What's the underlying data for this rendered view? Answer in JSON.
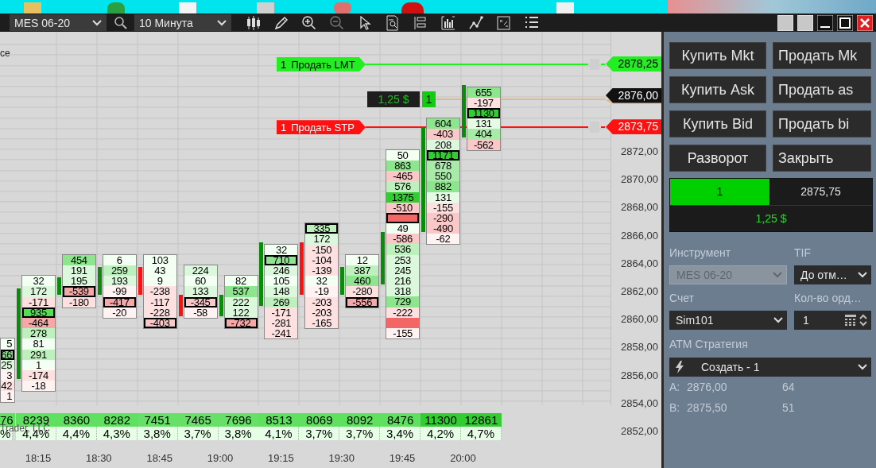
{
  "toolbar": {
    "instrument": "MES 06-20",
    "interval": "10 Минута"
  },
  "chart": {
    "corner_label": "ce",
    "copyright": "Trader, LLC",
    "columns": [
      {
        "volume": "76",
        "percent": "%",
        "color": "#5fe05f",
        "cells": [
          {
            "text": "5",
            "color": "#f2fff2",
            "highlighted": false
          },
          {
            "text": "66",
            "color": "#8de68d",
            "highlighted": true
          },
          {
            "text": "25",
            "color": "#dcf8dc",
            "highlighted": false
          },
          {
            "text": "3",
            "color": "#fff2f2",
            "highlighted": false
          },
          {
            "text": "42",
            "color": "#fde0e0",
            "highlighted": false
          },
          {
            "text": "1",
            "color": "#fff2f2",
            "highlighted": false
          }
        ]
      },
      {
        "volume": "8239",
        "percent": "4,4%",
        "color": "#5fe05f",
        "candle": {
          "color": "#0b8a0b"
        },
        "cells": [
          {
            "text": "32",
            "color": "#f2fff2",
            "highlighted": false
          },
          {
            "text": "172",
            "color": "#dcf8dc",
            "highlighted": false
          },
          {
            "text": "-171",
            "color": "#fde0e0",
            "highlighted": false
          },
          {
            "text": "935",
            "color": "#55dd55",
            "highlighted": true
          },
          {
            "text": "-464",
            "color": "#f6a8a8",
            "highlighted": false
          },
          {
            "text": "278",
            "color": "#bdf0bd",
            "highlighted": false
          },
          {
            "text": "81",
            "color": "#f2fff2",
            "highlighted": false
          },
          {
            "text": "291",
            "color": "#bdf0bd",
            "highlighted": false
          },
          {
            "text": "1",
            "color": "#f2fff2",
            "highlighted": false
          },
          {
            "text": "-174",
            "color": "#fde0e0",
            "highlighted": false
          },
          {
            "text": "-18",
            "color": "#fff2f2",
            "highlighted": false
          }
        ]
      },
      {
        "volume": "8360",
        "percent": "4,4%",
        "color": "#5fe05f",
        "candle": {
          "color": "#0b8a0b"
        },
        "cells": [
          {
            "text": "454",
            "color": "#8de68d",
            "highlighted": false
          },
          {
            "text": "191",
            "color": "#dcf8dc",
            "highlighted": false
          },
          {
            "text": "195",
            "color": "#dcf8dc",
            "highlighted": false
          },
          {
            "text": "-539",
            "color": "#f6a8a8",
            "highlighted": true
          },
          {
            "text": "-180",
            "color": "#fde0e0",
            "highlighted": false
          }
        ]
      },
      {
        "volume": "8282",
        "percent": "4,3%",
        "color": "#5fe05f",
        "candle": {
          "color": "#0b8a0b"
        },
        "cells": [
          {
            "text": "6",
            "color": "#f2fff2",
            "highlighted": false
          },
          {
            "text": "259",
            "color": "#bdf0bd",
            "highlighted": false
          },
          {
            "text": "193",
            "color": "#dcf8dc",
            "highlighted": false
          },
          {
            "text": "-99",
            "color": "#fff2f2",
            "highlighted": false
          },
          {
            "text": "-417",
            "color": "#f6a8a8",
            "highlighted": true
          },
          {
            "text": "-20",
            "color": "#fff2f2",
            "highlighted": false
          }
        ]
      },
      {
        "volume": "7451",
        "percent": "3,8%",
        "color": "#66e066",
        "candle": {
          "color": "#ff1010"
        },
        "cells": [
          {
            "text": "103",
            "color": "#f2fff2",
            "highlighted": false
          },
          {
            "text": "43",
            "color": "#f2fff2",
            "highlighted": false
          },
          {
            "text": "9",
            "color": "#f2fff2",
            "highlighted": false
          },
          {
            "text": "-238",
            "color": "#fde0e0",
            "highlighted": false
          },
          {
            "text": "-117",
            "color": "#fde0e0",
            "highlighted": false
          },
          {
            "text": "-228",
            "color": "#fde0e0",
            "highlighted": false
          },
          {
            "text": "-403",
            "color": "#fac8c8",
            "highlighted": true
          }
        ]
      },
      {
        "volume": "7465",
        "percent": "3,7%",
        "color": "#66e066",
        "candle": {
          "color": "#ff1010"
        },
        "cells": [
          {
            "text": "224",
            "color": "#dcf8dc",
            "highlighted": false
          },
          {
            "text": "60",
            "color": "#f2fff2",
            "highlighted": false
          },
          {
            "text": "133",
            "color": "#dcf8dc",
            "highlighted": false
          },
          {
            "text": "-345",
            "color": "#fac8c8",
            "highlighted": true
          },
          {
            "text": "-58",
            "color": "#fff2f2",
            "highlighted": false
          }
        ]
      },
      {
        "volume": "7696",
        "percent": "3,8%",
        "color": "#66e066",
        "candle": {
          "color": "#0b8a0b"
        },
        "cells": [
          {
            "text": "82",
            "color": "#f2fff2",
            "highlighted": false
          },
          {
            "text": "537",
            "color": "#8de68d",
            "highlighted": false
          },
          {
            "text": "222",
            "color": "#dcf8dc",
            "highlighted": false
          },
          {
            "text": "122",
            "color": "#dcf8dc",
            "highlighted": false
          },
          {
            "text": "-732",
            "color": "#f6a8a8",
            "highlighted": true
          }
        ]
      },
      {
        "volume": "8513",
        "percent": "4,1%",
        "color": "#5fe05f",
        "candle": {
          "color": "#0b8a0b"
        },
        "cells": [
          {
            "text": "32",
            "color": "#f2fff2",
            "highlighted": false
          },
          {
            "text": "710",
            "color": "#8de68d",
            "highlighted": true
          },
          {
            "text": "246",
            "color": "#dcf8dc",
            "highlighted": false
          },
          {
            "text": "105",
            "color": "#f2fff2",
            "highlighted": false
          },
          {
            "text": "148",
            "color": "#dcf8dc",
            "highlighted": false
          },
          {
            "text": "269",
            "color": "#bdf0bd",
            "highlighted": false
          },
          {
            "text": "-171",
            "color": "#fde0e0",
            "highlighted": false
          },
          {
            "text": "-281",
            "color": "#fde0e0",
            "highlighted": false
          },
          {
            "text": "-241",
            "color": "#fde0e0",
            "highlighted": false
          }
        ]
      },
      {
        "volume": "8069",
        "percent": "3,7%",
        "color": "#5fe05f",
        "candle": {
          "color": "#ff1010"
        },
        "cells": [
          {
            "text": "335",
            "color": "#bdf0bd",
            "highlighted": true
          },
          {
            "text": "172",
            "color": "#dcf8dc",
            "highlighted": false
          },
          {
            "text": "-150",
            "color": "#fde0e0",
            "highlighted": false
          },
          {
            "text": "-104",
            "color": "#fde0e0",
            "highlighted": false
          },
          {
            "text": "-139",
            "color": "#fde0e0",
            "highlighted": false
          },
          {
            "text": "32",
            "color": "#f2fff2",
            "highlighted": false
          },
          {
            "text": "-19",
            "color": "#fff2f2",
            "highlighted": false
          },
          {
            "text": "-203",
            "color": "#fde0e0",
            "highlighted": false
          },
          {
            "text": "-203",
            "color": "#fde0e0",
            "highlighted": false
          },
          {
            "text": "-165",
            "color": "#fde0e0",
            "highlighted": false
          }
        ]
      },
      {
        "volume": "8092",
        "percent": "3,7%",
        "color": "#5fe05f",
        "candle": {
          "color": "#0b8a0b"
        },
        "cells": [
          {
            "text": "12",
            "color": "#f2fff2",
            "highlighted": false
          },
          {
            "text": "387",
            "color": "#bdf0bd",
            "highlighted": false
          },
          {
            "text": "460",
            "color": "#8de68d",
            "highlighted": false
          },
          {
            "text": "-280",
            "color": "#fde0e0",
            "highlighted": false
          },
          {
            "text": "-556",
            "color": "#f6a8a8",
            "highlighted": true
          }
        ]
      },
      {
        "volume": "8476",
        "percent": "3,4%",
        "color": "#5fe05f",
        "candle": {
          "color": "#0b8a0b"
        },
        "cells": [
          {
            "text": "50",
            "color": "#f2fff2",
            "highlighted": false
          },
          {
            "text": "863",
            "color": "#8de68d",
            "highlighted": false
          },
          {
            "text": "-465",
            "color": "#fac8c8",
            "highlighted": false
          },
          {
            "text": "576",
            "color": "#bdf0bd",
            "highlighted": false
          },
          {
            "text": "1375",
            "color": "#33cc33",
            "highlighted": false
          },
          {
            "text": "-510",
            "color": "#fac8c8",
            "highlighted": false
          },
          {
            "color": "#f36666",
            "highlighted": true
          },
          {
            "text": "49",
            "color": "#f2fff2",
            "highlighted": false
          },
          {
            "text": "-586",
            "color": "#fac8c8",
            "highlighted": false
          },
          {
            "text": "536",
            "color": "#bdf0bd",
            "highlighted": false
          },
          {
            "text": "253",
            "color": "#dcf8dc",
            "highlighted": false
          },
          {
            "text": "245",
            "color": "#dcf8dc",
            "highlighted": false
          },
          {
            "text": "216",
            "color": "#dcf8dc",
            "highlighted": false
          },
          {
            "text": "318",
            "color": "#dcf8dc",
            "highlighted": false
          },
          {
            "text": "729",
            "color": "#8de68d",
            "highlighted": false
          },
          {
            "text": "-222",
            "color": "#fde0e0",
            "highlighted": false
          },
          {
            "color": "#f36666",
            "highlighted": false
          },
          {
            "text": "-155",
            "color": "#fff2f2",
            "highlighted": false
          }
        ]
      },
      {
        "volume": "11300",
        "percent": "4,2%",
        "color": "#33cc33",
        "candle": {
          "color": "#0b8a0b"
        },
        "cells": [
          {
            "text": "604",
            "color": "#8de68d",
            "highlighted": false
          },
          {
            "text": "-403",
            "color": "#fac8c8",
            "highlighted": false
          },
          {
            "text": "208",
            "color": "#dcf8dc",
            "highlighted": false
          },
          {
            "text": "1171",
            "color": "#33cc33",
            "highlighted": true
          },
          {
            "text": "678",
            "color": "#a8eaa8",
            "highlighted": false
          },
          {
            "text": "550",
            "color": "#a8eaa8",
            "highlighted": false
          },
          {
            "text": "882",
            "color": "#8de68d",
            "highlighted": false
          },
          {
            "text": "131",
            "color": "#e6fbe6",
            "highlighted": false
          },
          {
            "text": "-155",
            "color": "#fde0e0",
            "highlighted": false
          },
          {
            "text": "-290",
            "color": "#fac8c8",
            "highlighted": false
          },
          {
            "text": "-490",
            "color": "#fac8c8",
            "highlighted": false
          },
          {
            "text": "-62",
            "color": "#fff2f2",
            "highlighted": false
          }
        ]
      },
      {
        "volume": "12861",
        "percent": "4,7%",
        "color": "#33cc33",
        "candle": {
          "color": "#0b8a0b"
        },
        "cells": [
          {
            "text": "655",
            "color": "#8de68d",
            "highlighted": false
          },
          {
            "text": "-197",
            "color": "#fde0e0",
            "highlighted": false
          },
          {
            "text": "1130",
            "color": "#33cc33",
            "highlighted": true
          },
          {
            "text": "131",
            "color": "#e6fbe6",
            "highlighted": false
          },
          {
            "text": "404",
            "color": "#a8eaa8",
            "highlighted": false
          },
          {
            "text": "-562",
            "color": "#fac8c8",
            "highlighted": false
          }
        ]
      }
    ],
    "time_labels": [
      "18:15",
      "18:30",
      "18:45",
      "19:00",
      "19:15",
      "19:30",
      "19:45",
      "20:00"
    ],
    "price_labels": [
      "2872,00",
      "2870,00",
      "2868,00",
      "2866,00",
      "2864,00",
      "2862,00",
      "2860,00",
      "2858,00",
      "2856,00",
      "2854,00",
      "2852,00"
    ],
    "orders": [
      {
        "kind": "limit",
        "quantity": "1",
        "label": "Продать LMT",
        "price": "2878,25"
      },
      {
        "kind": "stop",
        "quantity": "1",
        "label": "Продать STP",
        "price": "2873,75"
      }
    ],
    "position": {
      "pnl": "1,25 $",
      "quantity": "1",
      "last_price": "2876,00"
    }
  },
  "order_panel": {
    "buttons": [
      "Купить Mkt",
      "Продать Mk",
      "Купить Ask",
      "Продать as",
      "Купить Bid",
      "Продать bi",
      "Разворот",
      "Закрыть"
    ],
    "position": {
      "quantity": "1",
      "price": "2875,75",
      "pnl": "1,25 $"
    },
    "instrument": {
      "label": "Инструмент",
      "value": "MES 06-20",
      "disabled": true
    },
    "tif": {
      "label": "TIF",
      "value": "До отм…"
    },
    "account": {
      "label": "Счет",
      "value": "Sim101"
    },
    "quantity": {
      "label": "Кол-во орд…",
      "value": "1"
    },
    "atm": {
      "label": "ATM Стратегия",
      "value": "Создать - 1"
    },
    "quotes": [
      {
        "side": "A:",
        "price": "2876,00",
        "size": "64"
      },
      {
        "side": "B:",
        "price": "2875,50",
        "size": "51"
      }
    ]
  }
}
